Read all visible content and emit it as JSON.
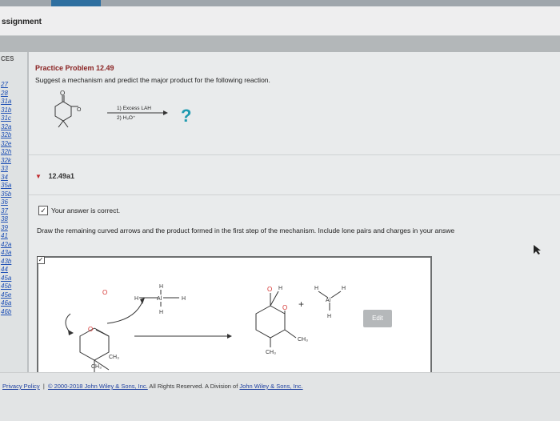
{
  "window": {
    "title": "ssignment"
  },
  "sidebar": {
    "header": "CES",
    "items": [
      "27",
      "28",
      "31a",
      "31b",
      "31c",
      "32a",
      "32b",
      "32e",
      "32h",
      "32k",
      "33",
      "34",
      "35a",
      "35b",
      "36",
      "37",
      "38",
      "39",
      "41",
      "42a",
      "43a",
      "43b",
      "44",
      "45a",
      "45b",
      "45e",
      "46a",
      "46b"
    ]
  },
  "problem": {
    "title": "Practice Problem 12.49",
    "prompt": "Suggest a mechanism and predict the major product for the following reaction.",
    "reagent1": "1) Excess LAH",
    "reagent2": "2) H₃O⁺",
    "unknown": "?"
  },
  "part": {
    "label": "12.49a1",
    "status": "Your answer is correct.",
    "instructions": "Draw the remaining curved arrows and the product formed in the first step of the mechanism. Include lone pairs and charges in your answe"
  },
  "drawing": {
    "h_label": "H",
    "al_label": "Al",
    "o_label": "O",
    "ch3_label": "CH₃",
    "plus": "+",
    "edit_label": "Edit"
  },
  "footer": {
    "privacy": "Privacy Policy",
    "separator": "|",
    "copyright": "© 2000-2018 John Wiley & Sons, Inc.",
    "rights": "All Rights Reserved. A Division of",
    "company": "John Wiley & Sons, Inc."
  },
  "colors": {
    "accent": "#8a2323",
    "link": "#1d4fb5",
    "lonepair": "#d4322f",
    "unknown": "#1f9ab0"
  }
}
